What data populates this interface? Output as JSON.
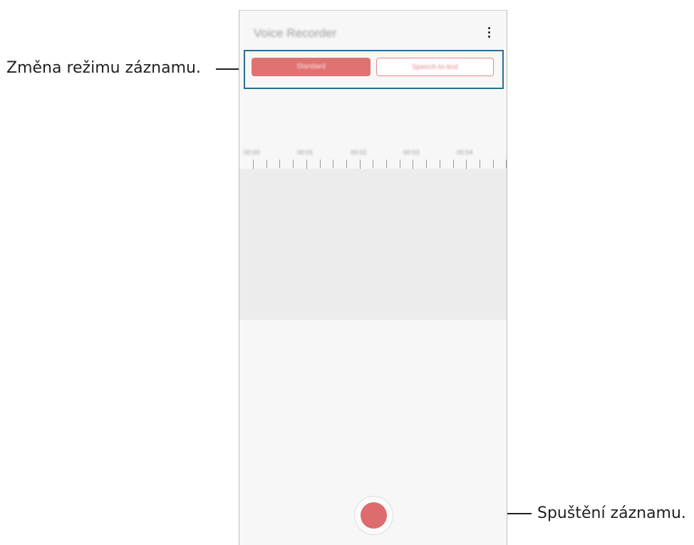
{
  "annotations": {
    "mode_change": "Změna režimu záznamu.",
    "start_recording": "Spuštění záznamu."
  },
  "app": {
    "title": "Voice Recorder",
    "modes": [
      "Standard",
      "Speech-to-text"
    ],
    "active_mode": "Standard"
  },
  "timeline": {
    "labels": [
      "00:00",
      "00:01",
      "00:02",
      "00:03",
      "00:04"
    ]
  },
  "icons": {
    "menu": "more-vertical-icon",
    "record": "record-icon"
  },
  "colors": {
    "accent": "#e07372",
    "callout_frame": "#2a6e93",
    "waveform_bg": "#ececec"
  }
}
